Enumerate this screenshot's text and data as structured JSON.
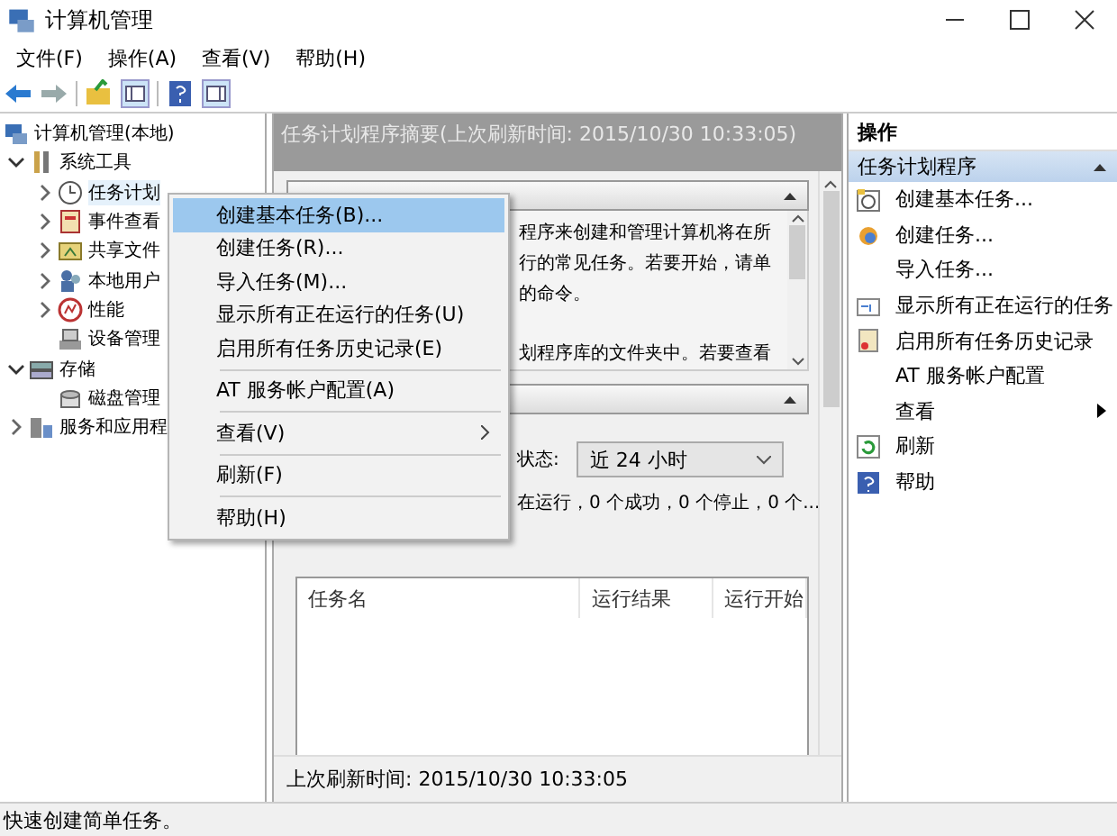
{
  "window": {
    "title": "计算机管理"
  },
  "menu_bar": [
    "文件(F)",
    "操作(A)",
    "查看(V)",
    "帮助(H)"
  ],
  "tree": [
    {
      "label": "计算机管理(本地)",
      "selected": false,
      "children": [
        {
          "label": "系统工具",
          "expanded": true,
          "selected": false,
          "children": [
            {
              "label": "任务计划",
              "expanded": false,
              "selected": true
            },
            {
              "label": "事件查看",
              "expanded": false,
              "selected": false
            },
            {
              "label": "共享文件",
              "expanded": false,
              "selected": false
            },
            {
              "label": "本地用户",
              "expanded": false,
              "selected": false
            },
            {
              "label": "性能",
              "expanded": false,
              "selected": false
            },
            {
              "label": "设备管理",
              "selected": false
            }
          ]
        },
        {
          "label": "存储",
          "expanded": true,
          "selected": false,
          "children": [
            {
              "label": "磁盘管理",
              "selected": false
            }
          ]
        },
        {
          "label": "服务和应用程",
          "expanded": false,
          "selected": false
        }
      ]
    }
  ],
  "summary": {
    "header": "任务计划程序摘要(上次刷新时间: 2015/10/30 10:33:05)",
    "overview_paragraphs": [
      [
        "程序来创建和管理计算机将在所",
        "行的常见任务。若要开始，请单",
        "的命令。"
      ],
      [
        "划程序库的文件夹中。若要查看"
      ]
    ],
    "status_label": "状态:",
    "period": "近 24 小时",
    "counts": "在运行，0 个成功，0 个停止，0 个...",
    "table": {
      "columns": [
        "任务名",
        "运行结果",
        "运行开始"
      ]
    },
    "footer": "上次刷新时间: 2015/10/30 10:33:05"
  },
  "actions": {
    "title": "操作",
    "section": "任务计划程序",
    "items": [
      {
        "label": "创建基本任务...",
        "kind": "command"
      },
      {
        "label": "创建任务...",
        "kind": "command"
      },
      {
        "label": "导入任务...",
        "kind": "command"
      },
      {
        "label": "显示所有正在运行的任务",
        "kind": "command"
      },
      {
        "label": "启用所有任务历史记录",
        "kind": "command"
      },
      {
        "label": "AT 服务帐户配置",
        "kind": "command"
      },
      {
        "label": "查看",
        "kind": "submenu"
      },
      {
        "label": "刷新",
        "kind": "command"
      },
      {
        "label": "帮助",
        "kind": "command"
      }
    ]
  },
  "context_menu": {
    "groups": [
      [
        {
          "label": "创建基本任务(B)...",
          "kind": "command",
          "selected": true
        },
        {
          "label": "创建任务(R)...",
          "kind": "command",
          "selected": false
        },
        {
          "label": "导入任务(M)...",
          "kind": "command",
          "selected": false
        },
        {
          "label": "显示所有正在运行的任务(U)",
          "kind": "command",
          "selected": false
        },
        {
          "label": "启用所有任务历史记录(E)",
          "kind": "command",
          "selected": false
        }
      ],
      [
        {
          "label": "AT 服务帐户配置(A)",
          "kind": "command",
          "selected": false
        }
      ],
      [
        {
          "label": "查看(V)",
          "kind": "submenu",
          "selected": false
        }
      ],
      [
        {
          "label": "刷新(F)",
          "kind": "command",
          "selected": false
        }
      ],
      [
        {
          "label": "帮助(H)",
          "kind": "command",
          "selected": false
        }
      ]
    ]
  },
  "status_bar": "快速创建简单任务。"
}
